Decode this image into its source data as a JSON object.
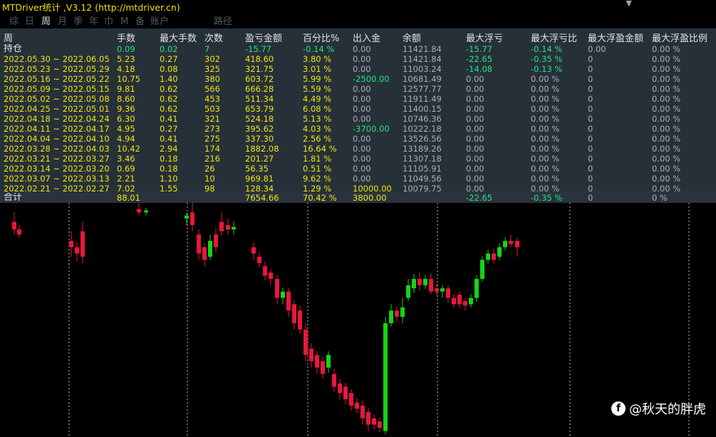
{
  "window": {
    "title": "MTDriver统计 ,V3.12 (http://mtdriver.cn)"
  },
  "tabs": [
    {
      "label": "综",
      "active": false
    },
    {
      "label": "日",
      "active": false
    },
    {
      "label": "周",
      "active": true
    },
    {
      "label": "月",
      "active": false
    },
    {
      "label": "季",
      "active": false
    },
    {
      "label": "年",
      "active": false
    },
    {
      "label": "巾",
      "active": false
    },
    {
      "label": "M",
      "active": false
    },
    {
      "label": "备",
      "active": false
    },
    {
      "label": "账户",
      "active": false
    },
    {
      "label": "路径",
      "active": false
    }
  ],
  "table": {
    "headers": [
      "周",
      "手数",
      "最大手数",
      "次数",
      "盈亏金额",
      "百分比%",
      "出入金",
      "余额",
      "最大浮亏",
      "最大浮亏比",
      "最大浮盈金额",
      "最大浮盈比例"
    ],
    "holding": {
      "label": "持仓",
      "values": [
        "0.09",
        "0.02",
        "7",
        "-15.77",
        "-0.14 %",
        "0.00",
        "11421.84",
        "-15.77",
        "-0.14 %",
        "0.00",
        "0.00 %"
      ]
    },
    "rows": [
      {
        "period": "2022.05.30 ~ 2022.06.05",
        "lots": "5.23",
        "max_lots": "0.27",
        "count": "302",
        "pnl": "418.60",
        "pct": "3.80 %",
        "io": "0.00",
        "balance": "11421.84",
        "max_float_loss": "-22.65",
        "max_float_loss_pct": "-0.35 %",
        "max_float_profit": "0",
        "max_float_profit_pct": "0.00 %"
      },
      {
        "period": "2022.05.23 ~ 2022.05.29",
        "lots": "4.18",
        "max_lots": "0.08",
        "count": "325",
        "pnl": "321.75",
        "pct": "3.01 %",
        "io": "0.00",
        "balance": "11003.24",
        "max_float_loss": "-14.08",
        "max_float_loss_pct": "-0.13 %",
        "max_float_profit": "0",
        "max_float_profit_pct": "0.00 %"
      },
      {
        "period": "2022.05.16 ~ 2022.05.22",
        "lots": "10.75",
        "max_lots": "1.40",
        "count": "380",
        "pnl": "603.72",
        "pct": "5.99 %",
        "io": "-2500.00",
        "balance": "10681.49",
        "max_float_loss": "0.00",
        "max_float_loss_pct": "0.00 %",
        "max_float_profit": "0",
        "max_float_profit_pct": "0.00 %"
      },
      {
        "period": "2022.05.09 ~ 2022.05.15",
        "lots": "9.81",
        "max_lots": "0.62",
        "count": "566",
        "pnl": "666.28",
        "pct": "5.59 %",
        "io": "0.00",
        "balance": "12577.77",
        "max_float_loss": "0.00",
        "max_float_loss_pct": "0.00 %",
        "max_float_profit": "0",
        "max_float_profit_pct": "0.00 %"
      },
      {
        "period": "2022.05.02 ~ 2022.05.08",
        "lots": "8.60",
        "max_lots": "0.62",
        "count": "453",
        "pnl": "511.34",
        "pct": "4.49 %",
        "io": "0.00",
        "balance": "11911.49",
        "max_float_loss": "0.00",
        "max_float_loss_pct": "0.00 %",
        "max_float_profit": "0",
        "max_float_profit_pct": "0.00 %"
      },
      {
        "period": "2022.04.25 ~ 2022.05.01",
        "lots": "9.36",
        "max_lots": "0.62",
        "count": "503",
        "pnl": "653.79",
        "pct": "6.08 %",
        "io": "0.00",
        "balance": "11400.15",
        "max_float_loss": "0.00",
        "max_float_loss_pct": "0.00 %",
        "max_float_profit": "0",
        "max_float_profit_pct": "0.00 %"
      },
      {
        "period": "2022.04.18 ~ 2022.04.24",
        "lots": "6.30",
        "max_lots": "0.41",
        "count": "321",
        "pnl": "524.18",
        "pct": "5.13 %",
        "io": "0.00",
        "balance": "10746.36",
        "max_float_loss": "0.00",
        "max_float_loss_pct": "0.00 %",
        "max_float_profit": "0",
        "max_float_profit_pct": "0.00 %"
      },
      {
        "period": "2022.04.11 ~ 2022.04.17",
        "lots": "4.95",
        "max_lots": "0.27",
        "count": "273",
        "pnl": "395.62",
        "pct": "4.03 %",
        "io": "-3700.00",
        "balance": "10222.18",
        "max_float_loss": "0.00",
        "max_float_loss_pct": "0.00 %",
        "max_float_profit": "0",
        "max_float_profit_pct": "0.00 %"
      },
      {
        "period": "2022.04.04 ~ 2022.04.10",
        "lots": "4.94",
        "max_lots": "0.41",
        "count": "275",
        "pnl": "337.30",
        "pct": "2.56 %",
        "io": "0.00",
        "balance": "13526.56",
        "max_float_loss": "0.00",
        "max_float_loss_pct": "0.00 %",
        "max_float_profit": "0",
        "max_float_profit_pct": "0.00 %"
      },
      {
        "period": "2022.03.28 ~ 2022.04.03",
        "lots": "10.42",
        "max_lots": "2.94",
        "count": "174",
        "pnl": "1882.08",
        "pct": "16.64 %",
        "io": "0.00",
        "balance": "13189.26",
        "max_float_loss": "0.00",
        "max_float_loss_pct": "0.00 %",
        "max_float_profit": "0",
        "max_float_profit_pct": "0.00 %"
      },
      {
        "period": "2022.03.21 ~ 2022.03.27",
        "lots": "3.46",
        "max_lots": "0.18",
        "count": "216",
        "pnl": "201.27",
        "pct": "1.81 %",
        "io": "0.00",
        "balance": "11307.18",
        "max_float_loss": "0.00",
        "max_float_loss_pct": "0.00 %",
        "max_float_profit": "0",
        "max_float_profit_pct": "0.00 %"
      },
      {
        "period": "2022.03.14 ~ 2022.03.20",
        "lots": "0.69",
        "max_lots": "0.18",
        "count": "26",
        "pnl": "56.35",
        "pct": "0.51 %",
        "io": "0.00",
        "balance": "11105.91",
        "max_float_loss": "0.00",
        "max_float_loss_pct": "0.00 %",
        "max_float_profit": "0",
        "max_float_profit_pct": "0.00 %"
      },
      {
        "period": "2022.03.07 ~ 2022.03.13",
        "lots": "2.21",
        "max_lots": "1.10",
        "count": "10",
        "pnl": "969.81",
        "pct": "9.62 %",
        "io": "0.00",
        "balance": "11049.56",
        "max_float_loss": "0.00",
        "max_float_loss_pct": "0.00 %",
        "max_float_profit": "0",
        "max_float_profit_pct": "0.00 %"
      },
      {
        "period": "2022.02.21 ~ 2022.02.27",
        "lots": "7.02",
        "max_lots": "1.55",
        "count": "98",
        "pnl": "128.34",
        "pct": "1.29 %",
        "io": "10000.00",
        "balance": "10079.75",
        "max_float_loss": "0.00",
        "max_float_loss_pct": "0.00 %",
        "max_float_profit": "0",
        "max_float_profit_pct": "0.00 %"
      }
    ],
    "total": {
      "label": "合计",
      "lots": "88.01",
      "pnl": "7654.66",
      "pct": "70.42 %",
      "io": "3800.00",
      "max_float_loss": "-22.65",
      "max_float_loss_pct": "-0.35 %",
      "max_float_profit": "0",
      "max_float_profit_pct": "0 %"
    }
  },
  "watermark": {
    "icon": "weibo-icon",
    "text": "@秋天的胖虎"
  },
  "colors": {
    "bull": "#16d416",
    "bear": "#e8173d",
    "panel": "#263039",
    "title": "#f0e000"
  }
}
